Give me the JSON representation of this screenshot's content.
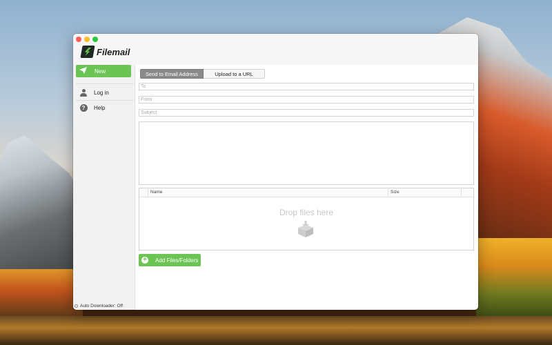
{
  "app": {
    "name": "Filemail"
  },
  "sidebar": {
    "items": [
      {
        "label": "New",
        "icon": "paper-plane-icon"
      },
      {
        "label": "Log in",
        "icon": "person-icon"
      },
      {
        "label": "Help",
        "icon": "help-icon"
      }
    ],
    "status": "Auto Downloader: Off"
  },
  "tabs": [
    {
      "label": "Send to Email Address",
      "active": true
    },
    {
      "label": "Upload to a URL",
      "active": false
    }
  ],
  "form": {
    "to_placeholder": "To",
    "from_placeholder": "From",
    "subject_placeholder": "Subject",
    "message_value": ""
  },
  "files": {
    "columns": [
      "Name",
      "Size"
    ],
    "empty_text": "Drop files here"
  },
  "actions": {
    "add_label": "Add Files/Folders"
  },
  "colors": {
    "accent": "#6cc454",
    "active_tab": "#8a8a8a",
    "close": "#fc5f57",
    "minimize": "#fdbc2e",
    "zoom": "#29c840"
  }
}
